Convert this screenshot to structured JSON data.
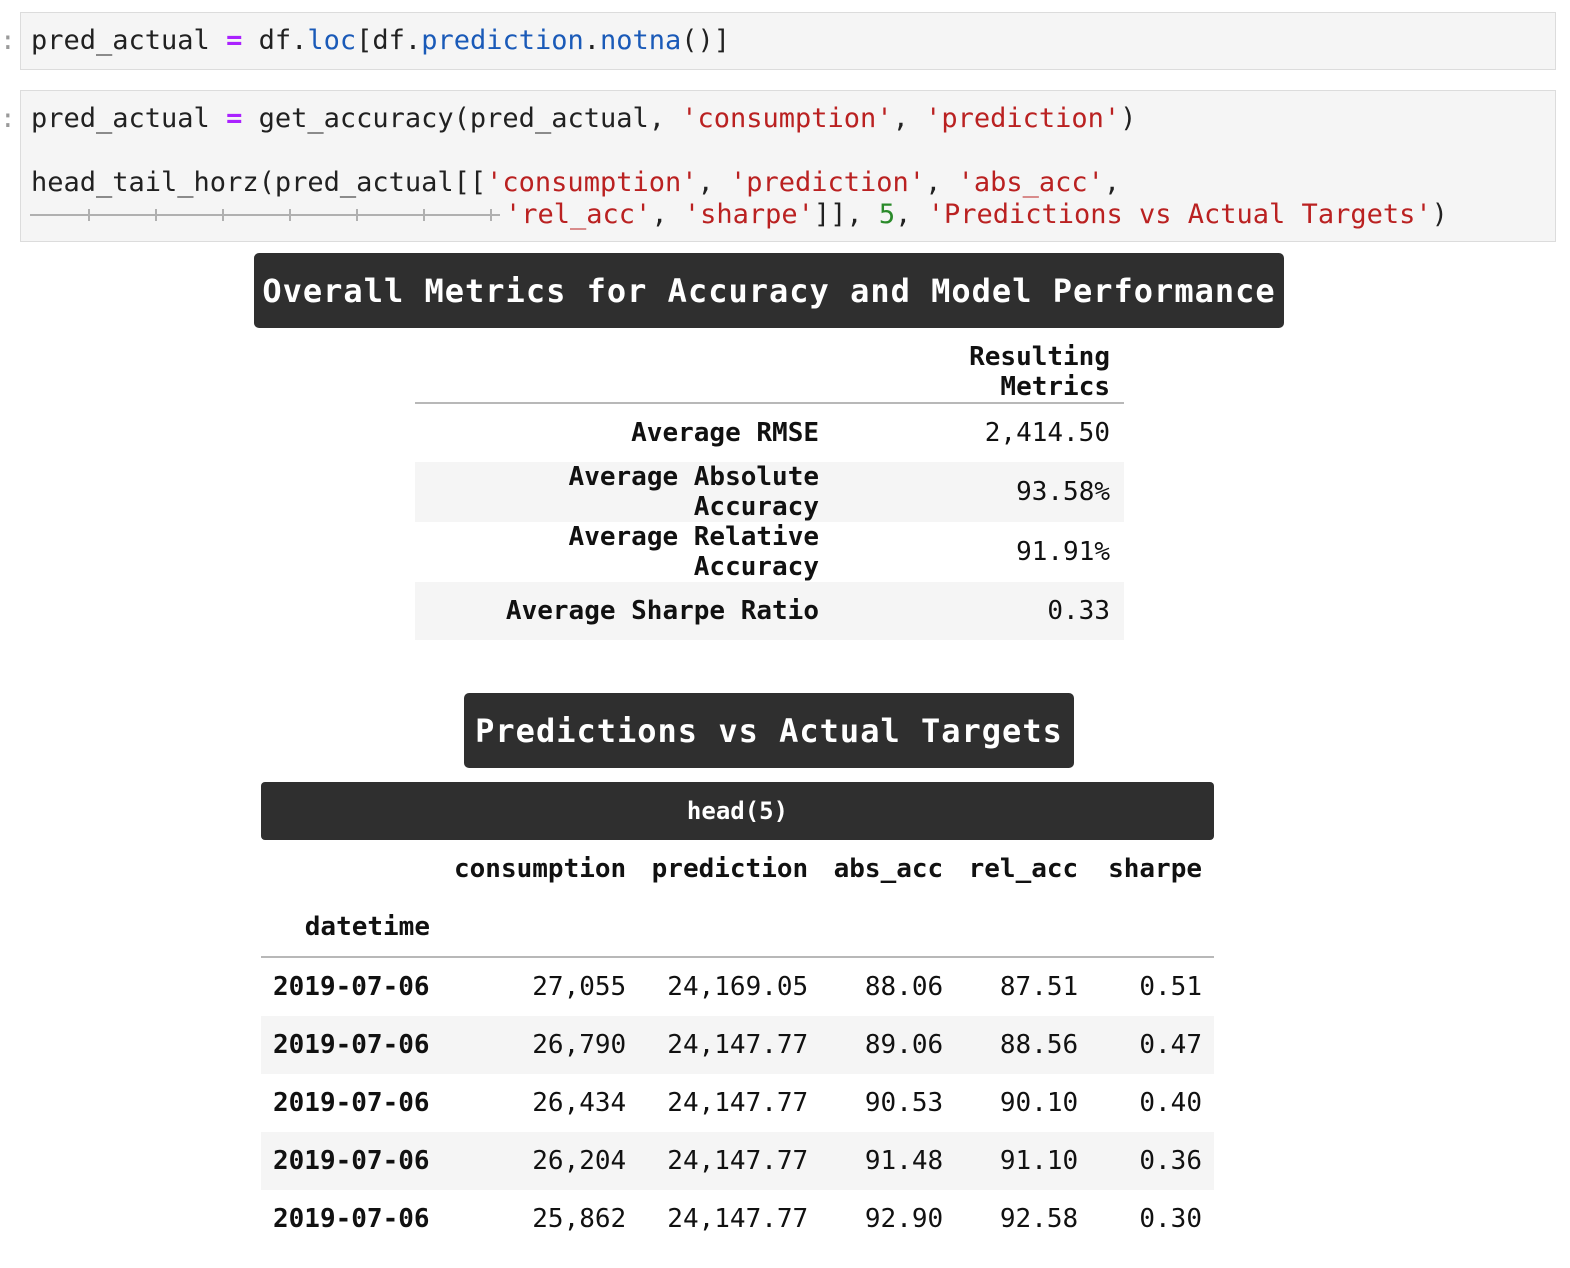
{
  "cells": {
    "cell1": {
      "line1": {
        "a": "pred_actual ",
        "op": "=",
        "b": " df.",
        "c": "loc",
        "d": "[df.",
        "e": "prediction",
        "f": ".",
        "g": "notna",
        "h": "()]"
      }
    },
    "cell2": {
      "line1": {
        "a": "pred_actual ",
        "op": "=",
        "b": " get_accuracy(pred_actual, ",
        "s1": "'consumption'",
        "c": ", ",
        "s2": "'prediction'",
        "d": ")"
      },
      "line2": {
        "a": "head_tail_horz(pred_actual[[",
        "s1": "'consumption'",
        "b": ", ",
        "s2": "'prediction'",
        "c": ", ",
        "s3": "'abs_acc'",
        "d": ","
      },
      "line3": {
        "s1": "'rel_acc'",
        "a": ", ",
        "s2": "'sharpe'",
        "b": "]], ",
        "n": "5",
        "c": ", ",
        "s3": "'Predictions vs Actual Targets'",
        "d": ")"
      }
    }
  },
  "metrics_title": "Overall Metrics for Accuracy and Model Performance",
  "metrics": {
    "column": "Resulting Metrics",
    "rows": [
      {
        "label": "Average RMSE",
        "value": "2,414.50"
      },
      {
        "label": "Average Absolute Accuracy",
        "value": "93.58%"
      },
      {
        "label": "Average Relative Accuracy",
        "value": "91.91%"
      },
      {
        "label": "Average Sharpe Ratio",
        "value": "0.33"
      }
    ]
  },
  "predictions_title": "Predictions vs Actual Targets",
  "head_label": "head(5)",
  "table": {
    "columns": [
      "consumption",
      "prediction",
      "abs_acc",
      "rel_acc",
      "sharpe"
    ],
    "index_name": "datetime",
    "rows": [
      {
        "idx": "2019-07-06",
        "c": [
          "27,055",
          "24,169.05",
          "88.06",
          "87.51",
          "0.51"
        ]
      },
      {
        "idx": "2019-07-06",
        "c": [
          "26,790",
          "24,147.77",
          "89.06",
          "88.56",
          "0.47"
        ]
      },
      {
        "idx": "2019-07-06",
        "c": [
          "26,434",
          "24,147.77",
          "90.53",
          "90.10",
          "0.40"
        ]
      },
      {
        "idx": "2019-07-06",
        "c": [
          "26,204",
          "24,147.77",
          "91.48",
          "91.10",
          "0.36"
        ]
      },
      {
        "idx": "2019-07-06",
        "c": [
          "25,862",
          "24,147.77",
          "92.90",
          "92.58",
          "0.30"
        ]
      }
    ]
  }
}
